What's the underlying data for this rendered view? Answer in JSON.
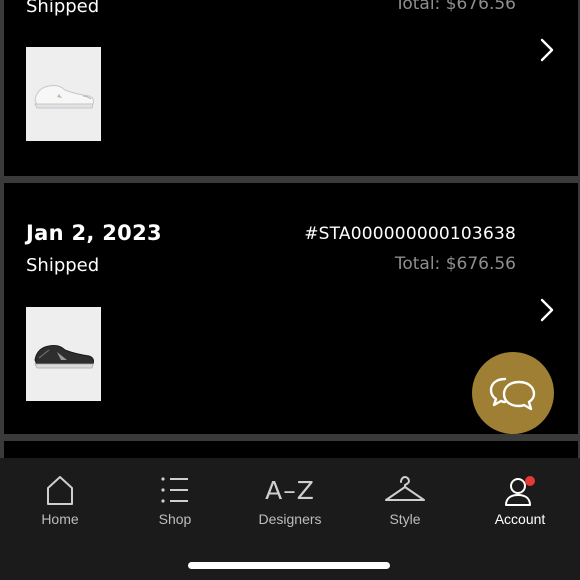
{
  "orders": [
    {
      "status": "Shipped",
      "total": "Total: $676.56",
      "product_image": "white-sneaker"
    },
    {
      "date": "Jan 2, 2023",
      "order_number": "#STA000000000103638",
      "status": "Shipped",
      "total": "Total: $676.56",
      "product_image": "black-sneaker"
    }
  ],
  "chat": {
    "icon": "chat-bubbles-icon",
    "color": "#9e7f33"
  },
  "tabbar": {
    "tabs": [
      {
        "label": "Home",
        "icon": "home-icon"
      },
      {
        "label": "Shop",
        "icon": "list-icon"
      },
      {
        "label": "Designers",
        "icon_text": "A–Z"
      },
      {
        "label": "Style",
        "icon": "hanger-icon"
      },
      {
        "label": "Account",
        "icon": "account-icon",
        "active": true,
        "badge_color": "#e53935"
      }
    ]
  }
}
